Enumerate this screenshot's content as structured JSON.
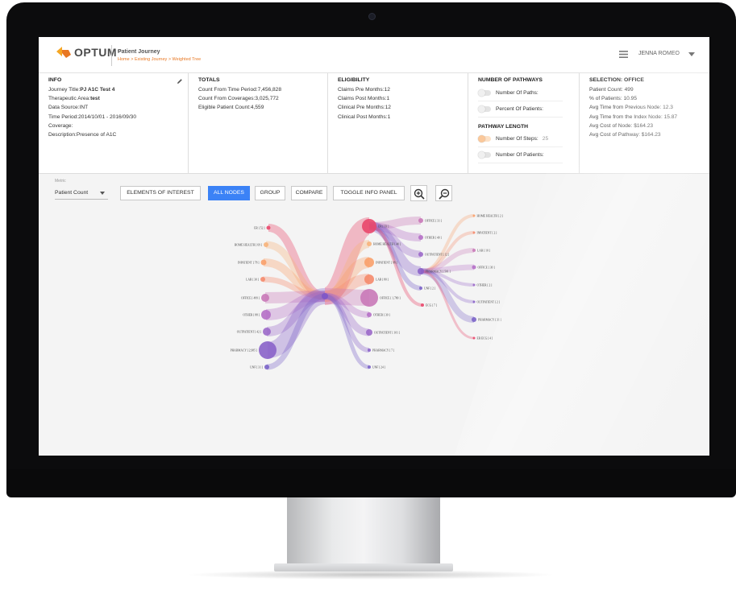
{
  "header": {
    "brand": "OPTUM",
    "brand_tm": "™",
    "app_title": "Patient Journey",
    "breadcrumb": "Home > Existing Journey > Weighted Tree",
    "user_name": "JENNA ROMEO"
  },
  "info": {
    "title": "INFO",
    "journey_title_label": "Journey Title:",
    "journey_title_value": "PJ A1C Test 4",
    "therapeutic_area_label": "Therapeutic Area:",
    "therapeutic_area_value": "test",
    "data_source": "Data Source:INT",
    "time_period": "Time Period:2014/10/01 - 2016/09/30",
    "coverage": "Coverage:",
    "description": "Description:Presence of A1C"
  },
  "totals": {
    "title": "TOTALS",
    "lines": [
      "Count From Time Period:7,456,828",
      "Count From Coverages:3,025,772",
      "Eligible Patient Count:4,559"
    ]
  },
  "eligibility": {
    "title": "ELIGIBILITY",
    "lines": [
      "Claims Pre Months:12",
      "Claims Post Months:1",
      "Clinical Pre Months:12",
      "Clinical Post Months:1"
    ]
  },
  "pathways": {
    "title": "NUMBER OF PATHWAYS",
    "number_of_paths": "Number Of Paths:",
    "percent_of_patients": "Percent Of Patients:",
    "length_title": "PATHWAY LENGTH",
    "number_of_steps": "Number Of Steps:",
    "number_of_steps_value": "25",
    "number_of_patients": "Number Of Patients:"
  },
  "selection": {
    "title": "SELECTION: OFFICE",
    "lines": [
      "Patient Count: 499",
      "% of Patients: 10.95",
      "Avg Time from Previous Node: 12.3",
      "Avg Time from the Index Node: 15.87",
      "Avg Cost of Node: $164.23",
      "Avg Cost of Pathway: $164.23"
    ]
  },
  "toolbar": {
    "metric_caption": "Metric",
    "metric_value": "Patient Count",
    "elements_of_interest": "ELEMENTS OF INTEREST",
    "all_nodes": "ALL NODES",
    "group": "GROUP",
    "compare": "COMPARE",
    "toggle_info_panel": "TOGGLE INFO PANEL"
  },
  "tree": {
    "left_nodes": [
      "ER [ 52 ]",
      "HOME HEALTH [ 69 ]",
      "INPATIENT [ 78 ]",
      "LAB [ 30 ]",
      "OFFICE [ 499 ]",
      "OTHER [ 88 ]",
      "OUTPATIENT [ 42 ]",
      "PHARMACY [ 2,985 ]",
      "UNF [ 31 ]"
    ],
    "mid_nodes": [
      "ER [ 93 ]",
      "HOME HEALTH [ 40 ]",
      "INPATIENT [ 98 ]",
      "LAB [ 80 ]",
      "OFFICE [ 1,780 ]",
      "OTHER [ 30 ]",
      "OUTPATIENT [ 101 ]",
      "PHARMACY [ 7 ]",
      "UNF [ 24 ]"
    ],
    "right_nodes": [
      "OFFICE [ 31 ]",
      "OTHER [ 40 ]",
      "OUTPATIENT [ 12 ]",
      "PHARMACY [ 501 ]",
      "UNF [ 2 ]",
      "ECG [ 7 ]"
    ],
    "far_nodes": [
      "HOME HEALTH [ 2 ]",
      "INPATIENT [ 2 ]",
      "LAB [ 10 ]",
      "OFFICE [ 30 ]",
      "OTHER [ 2 ]",
      "OUTPATIENT [ 2 ]",
      "PHARMACY [ 31 ]",
      "ER ECG [ 4 ]"
    ]
  },
  "colors": {
    "accent_blue": "#3b82f6",
    "brand_orange": "#e87722"
  }
}
